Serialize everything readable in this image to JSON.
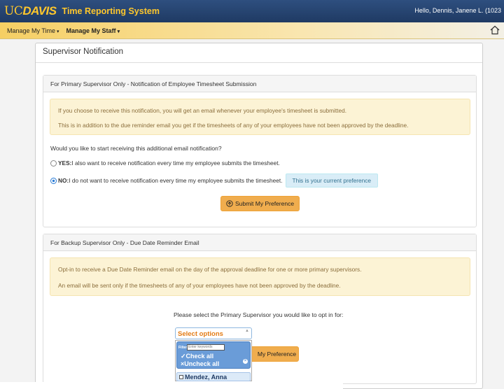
{
  "header": {
    "logo_uc": "UC",
    "logo_davis": "DAVIS",
    "app_title": "Time Reporting System",
    "greeting": "Hello, Dennis, Janene L. (1023"
  },
  "nav": {
    "items": [
      {
        "label": "Manage My Time",
        "caret": "▾"
      },
      {
        "label": "Manage My Staff",
        "caret": "▾"
      }
    ],
    "home_icon": "home-icon"
  },
  "main": {
    "title": "Supervisor Notification",
    "primary": {
      "heading": "For Primary Supervisor Only - Notification of Employee Timesheet Submission",
      "alert_lines": [
        "If you choose to receive this notification, you will get an email whenever your employee's timesheet is submitted.",
        "This is in addition to the due reminder email you get if the timesheets of any of your employees have not been approved by the deadline."
      ],
      "question": "Would you like to start receiving this additional email notification?",
      "options": [
        {
          "label": "YES:",
          "text": " I also want to receive notification every time my employee submits the timesheet.",
          "checked": false
        },
        {
          "label": "NO:",
          "text": " I do not want to receive notification every time my employee submits the timesheet.",
          "checked": true
        }
      ],
      "current_preference": "This is your current preference",
      "submit_label": "Submit My Preference"
    },
    "backup": {
      "heading": "For Backup Supervisor Only - Due Date Reminder Email",
      "alert_lines": [
        "Opt-in to receive a Due Date Reminder email on the day of the approval deadline for one or more primary supervisors.",
        "An email will be sent only if the timesheets of any of your employees have not been approved by the deadline."
      ],
      "select_prompt": "Please select the Primary Supervisor you would like to opt in for:",
      "select_placeholder": "Select options",
      "submit_label": "My Preference",
      "dropdown": {
        "filter_label": "Filter:",
        "filter_placeholder": "Enter keywords",
        "check_all": "Check all",
        "uncheck_all": "Uncheck all",
        "options": [
          "Mendez, Anna"
        ]
      }
    }
  },
  "colors": {
    "header_bg": "#1f3a63",
    "brand_gold": "#ffc72c",
    "warning_btn": "#f0ad4e",
    "info_bg": "#d9edf7"
  }
}
